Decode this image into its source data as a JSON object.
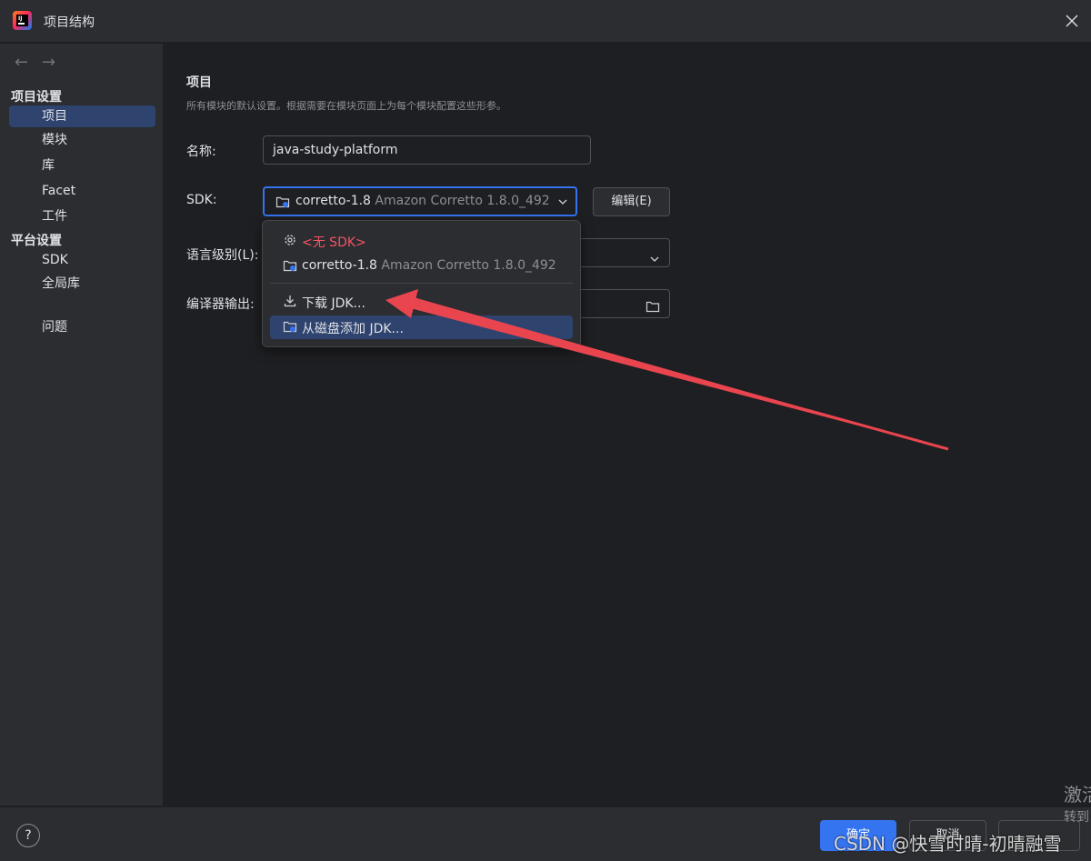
{
  "window": {
    "title": "项目结构"
  },
  "sidebar": {
    "back_arrow": "←",
    "forward_arrow": "→",
    "project_settings_label": "项目设置",
    "items": [
      {
        "label": "项目",
        "selected": true
      },
      {
        "label": "模块"
      },
      {
        "label": "库"
      },
      {
        "label": "Facet"
      },
      {
        "label": "工件"
      }
    ],
    "platform_settings_label": "平台设置",
    "platform_items": [
      {
        "label": "SDK"
      },
      {
        "label": "全局库"
      }
    ],
    "problems_label": "问题"
  },
  "main": {
    "title": "项目",
    "description": "所有模块的默认设置。根据需要在模块页面上为每个模块配置这些形参。",
    "name_label": "名称:",
    "name_value": "java-study-platform",
    "sdk_label": "SDK:",
    "sdk_selected_name": "corretto-1.8",
    "sdk_selected_detail": "Amazon Corretto 1.8.0_492",
    "edit_button": "编辑(E)",
    "language_level_label": "语言级别(L):",
    "compiler_output_label": "编译器输出:"
  },
  "sdk_popup": {
    "no_sdk": "<无 SDK>",
    "option_name": "corretto-1.8",
    "option_detail": "Amazon Corretto 1.8.0_492",
    "download_jdk": "下载 JDK...",
    "add_from_disk": "从磁盘添加 JDK..."
  },
  "footer": {
    "help": "?",
    "ok": "确定",
    "cancel": "取消"
  },
  "overlay": {
    "activate_title": "激活",
    "activate_sub": "转到",
    "watermark": "CSDN @快雪时晴-初晴融雪",
    "arrow_color": "#e8454f"
  },
  "colors": {
    "accent": "#3574f0",
    "selection": "#2e436e",
    "panel": "#2b2d30",
    "background": "#1e1f22"
  }
}
